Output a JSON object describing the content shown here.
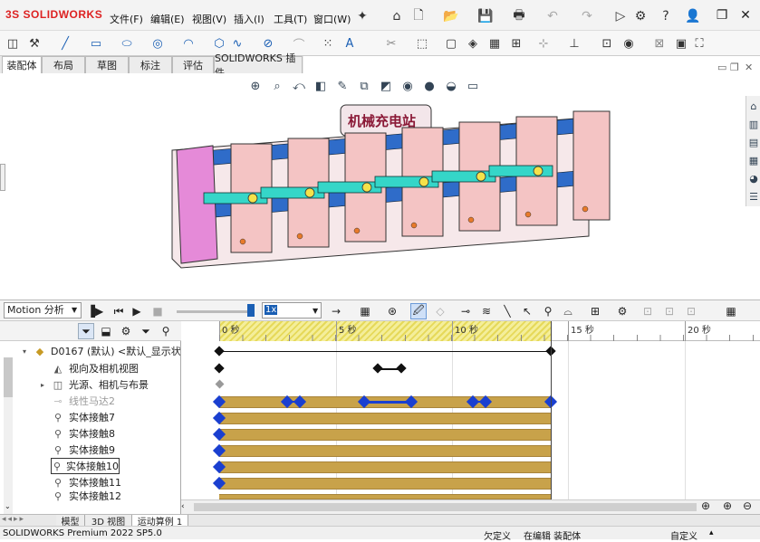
{
  "app": {
    "logo_prefix": "3S",
    "logo_text": "SOLIDWORKS"
  },
  "menu": [
    {
      "label": "文件(F)"
    },
    {
      "label": "编辑(E)"
    },
    {
      "label": "视图(V)"
    },
    {
      "label": "插入(I)"
    },
    {
      "label": "工具(T)"
    },
    {
      "label": "窗口(W)"
    }
  ],
  "titlebar_icons": [
    "home-icon",
    "new-doc-icon",
    "open-icon",
    "save-icon",
    "print-icon",
    "undo-icon",
    "redo-icon",
    "select-icon",
    "options-icon",
    "help-icon",
    "user-icon"
  ],
  "tabs": [
    {
      "label": "装配体"
    },
    {
      "label": "布局"
    },
    {
      "label": "草图"
    },
    {
      "label": "标注"
    },
    {
      "label": "评估"
    },
    {
      "label": "SOLIDWORKS 插件"
    }
  ],
  "active_tab": "装配体",
  "model_label": "机械充电站",
  "motion": {
    "study_type": "Motion 分析",
    "speed": "1x"
  },
  "timeline": {
    "ticks": [
      {
        "label": "0 秒"
      },
      {
        "label": "5 秒"
      },
      {
        "label": "10 秒"
      },
      {
        "label": "15 秒"
      },
      {
        "label": "20 秒"
      }
    ]
  },
  "tree": {
    "root": "D0167 (默认) <默认_显示状态",
    "items": [
      {
        "label": "视向及相机视图"
      },
      {
        "label": "光源、相机与布景"
      },
      {
        "label": "线性马达2"
      },
      {
        "label": "实体接触7"
      },
      {
        "label": "实体接触8"
      },
      {
        "label": "实体接触9"
      },
      {
        "label": "实体接触10"
      },
      {
        "label": "实体接触11"
      },
      {
        "label": "实体接触12"
      }
    ]
  },
  "bottom_tabs": [
    {
      "label": "模型"
    },
    {
      "label": "3D 视图"
    },
    {
      "label": "运动算例 1"
    }
  ],
  "status": {
    "product": "SOLIDWORKS Premium 2022 SP5.0",
    "state1": "欠定义",
    "state2": "在编辑 装配体",
    "state3": "自定义"
  },
  "colors": {
    "accent": "#1a5fb4",
    "keyframe": "#1a3fd0",
    "bar": "#c8a24a",
    "band": "#e6d95a",
    "logo_red": "#d22222"
  }
}
